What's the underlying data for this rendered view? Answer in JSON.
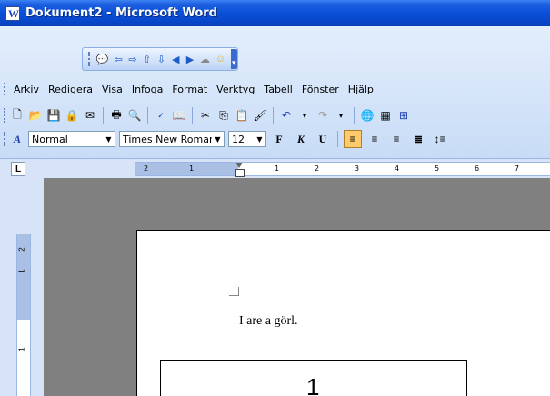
{
  "window": {
    "title": "Dokument2 - Microsoft Word"
  },
  "floating_toolbar": {
    "icons": [
      "speech-bubble-icon",
      "arrow-left-icon",
      "arrow-right-icon",
      "arrow-up-icon",
      "arrow-down-icon",
      "triangle-left-icon",
      "triangle-right-icon",
      "brain-icon",
      "smiley-icon"
    ]
  },
  "menubar": {
    "items": [
      {
        "pre": "",
        "key": "A",
        "post": "rkiv"
      },
      {
        "pre": "",
        "key": "R",
        "post": "edigera"
      },
      {
        "pre": "",
        "key": "V",
        "post": "isa"
      },
      {
        "pre": "",
        "key": "I",
        "post": "nfoga"
      },
      {
        "pre": "Forma",
        "key": "t",
        "post": ""
      },
      {
        "pre": "Verkty",
        "key": "g",
        "post": ""
      },
      {
        "pre": "Ta",
        "key": "b",
        "post": "ell"
      },
      {
        "pre": "F",
        "key": "ö",
        "post": "nster"
      },
      {
        "pre": "",
        "key": "H",
        "post": "jälp"
      }
    ]
  },
  "formatting": {
    "style": "Normal",
    "font": "Times New Roman",
    "size": "12",
    "bold_label": "F",
    "italic_label": "K",
    "underline_label": "U"
  },
  "ruler": {
    "h_ticks": [
      "2",
      "1",
      "1",
      "2",
      "3",
      "4",
      "5",
      "6",
      "7"
    ],
    "v_ticks": [
      "2",
      "1",
      "1"
    ]
  },
  "document": {
    "body_text": "I are a görl.",
    "box_text": "1"
  },
  "colors": {
    "title_bar": "#0a4fd8",
    "toolbar_bg": "#c8dcf7",
    "active_button": "#ffcb6a"
  }
}
